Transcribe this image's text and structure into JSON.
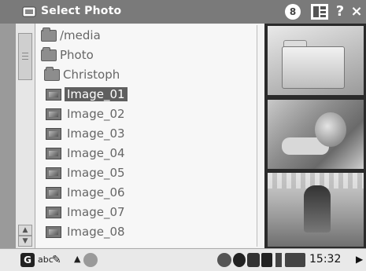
{
  "window": {
    "title": "Select Photo",
    "title_icon": "photo-folder-icon",
    "badge_number": "8",
    "buttons": [
      {
        "name": "view-toggle",
        "icon": "grid-view-icon"
      },
      {
        "name": "help",
        "label": "?"
      },
      {
        "name": "close",
        "label": "×"
      }
    ]
  },
  "list": {
    "items": [
      {
        "label": "/media",
        "icon": "folder-icon",
        "selected": false
      },
      {
        "label": "Photo",
        "icon": "folder-icon",
        "selected": false
      },
      {
        "label": "Christoph",
        "icon": "folder-icon",
        "selected": false
      },
      {
        "label": "Image_01",
        "icon": "image-file-icon",
        "selected": true
      },
      {
        "label": "Image_02",
        "icon": "image-file-icon",
        "selected": false
      },
      {
        "label": "Image_03",
        "icon": "image-file-icon",
        "selected": false
      },
      {
        "label": "Image_04",
        "icon": "image-file-icon",
        "selected": false
      },
      {
        "label": "Image_05",
        "icon": "image-file-icon",
        "selected": false
      },
      {
        "label": "Image_06",
        "icon": "image-file-icon",
        "selected": false
      },
      {
        "label": "Image_07",
        "icon": "image-file-icon",
        "selected": false
      },
      {
        "label": "Image_08",
        "icon": "image-file-icon",
        "selected": false
      }
    ]
  },
  "preview": {
    "thumbnails": [
      "folder-thumbnail",
      "portrait-photo-thumbnail",
      "figure-photo-thumbnail"
    ]
  },
  "taskbar": {
    "input_mode": "abc",
    "time": "15:32",
    "icons": [
      "start-logo-icon",
      "pen-icon",
      "up-arrow-icon",
      "app-icon",
      "network-icon",
      "sync-icon",
      "usb-icon",
      "storage-icon",
      "battery-icon",
      "volume-icon",
      "more-arrow-icon"
    ]
  },
  "colors": {
    "titlebar": "#7a7a7a",
    "selection": "#5f5f5f",
    "list_text": "#666666"
  }
}
